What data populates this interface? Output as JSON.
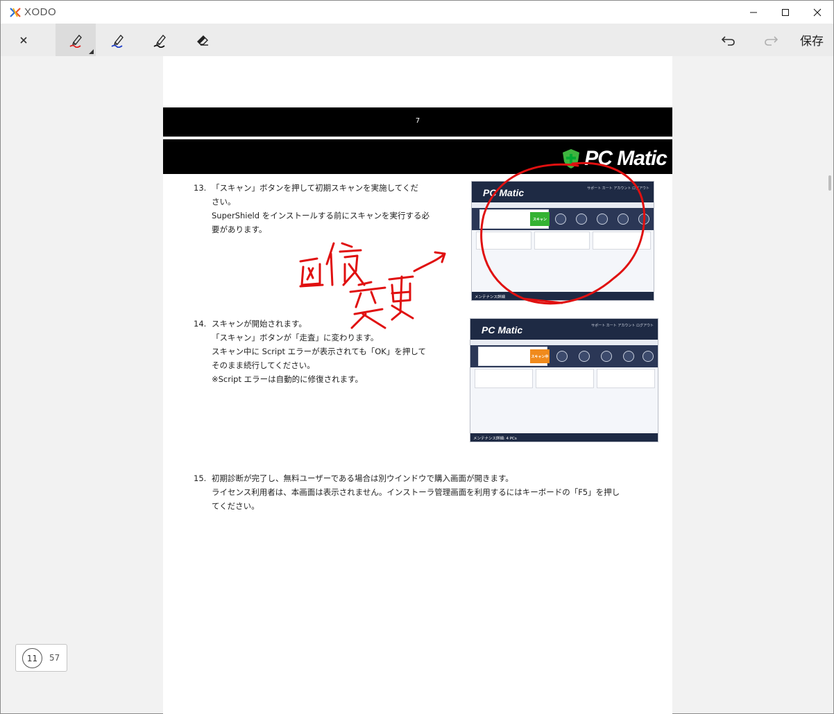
{
  "app": {
    "name": "XODO"
  },
  "window_controls": {
    "minimize": "minimize-icon",
    "maximize": "maximize-icon",
    "close": "close-icon"
  },
  "toolbar": {
    "close_icon": "close-icon",
    "tools": [
      {
        "name": "pen-red",
        "color": "#e02020",
        "active": true
      },
      {
        "name": "pen-blue",
        "color": "#1f3fc8",
        "active": false
      },
      {
        "name": "pen-black",
        "color": "#111111",
        "active": false
      },
      {
        "name": "eraser",
        "active": false
      }
    ],
    "undo_icon": "undo-icon",
    "redo_icon": "redo-icon",
    "save_label": "保存"
  },
  "document": {
    "page_number": "7",
    "brand": "PC Matic",
    "steps": [
      {
        "num": "13.",
        "lines": [
          "「スキャン」ボタンを押して初期スキャンを実施してくだ",
          "さい。",
          "SuperShield をインストールする前にスキャンを実行する必",
          "要があります。"
        ]
      },
      {
        "num": "14.",
        "lines": [
          "スキャンが開始されます。",
          "「スキャン」ボタンが「走査」に変わります。",
          "スキャン中に Script エラーが表示されても「OK」を押して",
          "そのまま続行してください。",
          "※Script エラーは自動的に修復されます。"
        ]
      },
      {
        "num": "15.",
        "lines": [
          "初期診断が完了し、無料ユーザーである場合は別ウインドウで購入画面が開きます。",
          "ライセンス利用者は、本画面は表示されません。インストーラ管理画面を利用するにはキーボードの「F5」を押し",
          "てください。"
        ]
      }
    ],
    "screenshots": [
      {
        "logo": "PC Matic",
        "top_links": "サポート  カート  アカウント  ログアウト",
        "scan_button": "スキャン",
        "scan_color": "#34b233",
        "footer": "メンテナンス詳細"
      },
      {
        "logo": "PC Matic",
        "top_links": "サポート  カート  アカウント  ログアウト",
        "scan_button": "スキャン中",
        "scan_color": "#f08a1c",
        "footer": "メンテナンス詳細: 4 PCs"
      }
    ],
    "annotation": {
      "text": "画像変更",
      "color": "#e01010"
    }
  },
  "page_counter": {
    "current": "11",
    "total": "57"
  }
}
